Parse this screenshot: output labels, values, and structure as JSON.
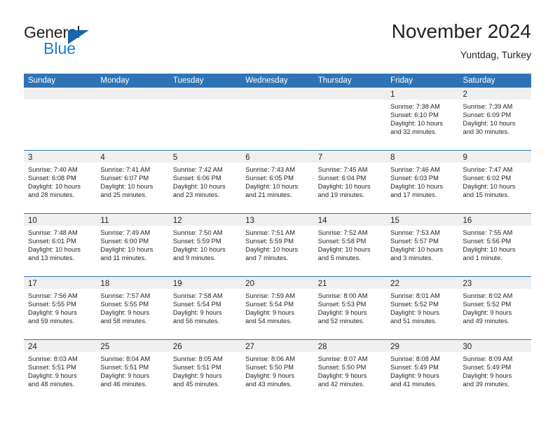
{
  "brand": {
    "name_part1": "General",
    "name_part2": "Blue",
    "mark": "triangle-flag"
  },
  "header": {
    "title": "November 2024",
    "subtitle": "Yuntdag, Turkey"
  },
  "colors": {
    "header_blue": "#2e74b5",
    "brand_blue": "#1b7fd4",
    "mark_blue": "#1866ad",
    "day_band_gray": "#efeff0",
    "text": "#231f20"
  },
  "weekday_headers": [
    "Sunday",
    "Monday",
    "Tuesday",
    "Wednesday",
    "Thursday",
    "Friday",
    "Saturday"
  ],
  "weeks": [
    [
      {
        "day": "",
        "sunrise": "",
        "sunset": "",
        "daylight1": "",
        "daylight2": ""
      },
      {
        "day": "",
        "sunrise": "",
        "sunset": "",
        "daylight1": "",
        "daylight2": ""
      },
      {
        "day": "",
        "sunrise": "",
        "sunset": "",
        "daylight1": "",
        "daylight2": ""
      },
      {
        "day": "",
        "sunrise": "",
        "sunset": "",
        "daylight1": "",
        "daylight2": ""
      },
      {
        "day": "",
        "sunrise": "",
        "sunset": "",
        "daylight1": "",
        "daylight2": ""
      },
      {
        "day": "1",
        "sunrise": "Sunrise: 7:38 AM",
        "sunset": "Sunset: 6:10 PM",
        "daylight1": "Daylight: 10 hours",
        "daylight2": "and 32 minutes."
      },
      {
        "day": "2",
        "sunrise": "Sunrise: 7:39 AM",
        "sunset": "Sunset: 6:09 PM",
        "daylight1": "Daylight: 10 hours",
        "daylight2": "and 30 minutes."
      }
    ],
    [
      {
        "day": "3",
        "sunrise": "Sunrise: 7:40 AM",
        "sunset": "Sunset: 6:08 PM",
        "daylight1": "Daylight: 10 hours",
        "daylight2": "and 28 minutes."
      },
      {
        "day": "4",
        "sunrise": "Sunrise: 7:41 AM",
        "sunset": "Sunset: 6:07 PM",
        "daylight1": "Daylight: 10 hours",
        "daylight2": "and 25 minutes."
      },
      {
        "day": "5",
        "sunrise": "Sunrise: 7:42 AM",
        "sunset": "Sunset: 6:06 PM",
        "daylight1": "Daylight: 10 hours",
        "daylight2": "and 23 minutes."
      },
      {
        "day": "6",
        "sunrise": "Sunrise: 7:43 AM",
        "sunset": "Sunset: 6:05 PM",
        "daylight1": "Daylight: 10 hours",
        "daylight2": "and 21 minutes."
      },
      {
        "day": "7",
        "sunrise": "Sunrise: 7:45 AM",
        "sunset": "Sunset: 6:04 PM",
        "daylight1": "Daylight: 10 hours",
        "daylight2": "and 19 minutes."
      },
      {
        "day": "8",
        "sunrise": "Sunrise: 7:46 AM",
        "sunset": "Sunset: 6:03 PM",
        "daylight1": "Daylight: 10 hours",
        "daylight2": "and 17 minutes."
      },
      {
        "day": "9",
        "sunrise": "Sunrise: 7:47 AM",
        "sunset": "Sunset: 6:02 PM",
        "daylight1": "Daylight: 10 hours",
        "daylight2": "and 15 minutes."
      }
    ],
    [
      {
        "day": "10",
        "sunrise": "Sunrise: 7:48 AM",
        "sunset": "Sunset: 6:01 PM",
        "daylight1": "Daylight: 10 hours",
        "daylight2": "and 13 minutes."
      },
      {
        "day": "11",
        "sunrise": "Sunrise: 7:49 AM",
        "sunset": "Sunset: 6:00 PM",
        "daylight1": "Daylight: 10 hours",
        "daylight2": "and 11 minutes."
      },
      {
        "day": "12",
        "sunrise": "Sunrise: 7:50 AM",
        "sunset": "Sunset: 5:59 PM",
        "daylight1": "Daylight: 10 hours",
        "daylight2": "and 9 minutes."
      },
      {
        "day": "13",
        "sunrise": "Sunrise: 7:51 AM",
        "sunset": "Sunset: 5:59 PM",
        "daylight1": "Daylight: 10 hours",
        "daylight2": "and 7 minutes."
      },
      {
        "day": "14",
        "sunrise": "Sunrise: 7:52 AM",
        "sunset": "Sunset: 5:58 PM",
        "daylight1": "Daylight: 10 hours",
        "daylight2": "and 5 minutes."
      },
      {
        "day": "15",
        "sunrise": "Sunrise: 7:53 AM",
        "sunset": "Sunset: 5:57 PM",
        "daylight1": "Daylight: 10 hours",
        "daylight2": "and 3 minutes."
      },
      {
        "day": "16",
        "sunrise": "Sunrise: 7:55 AM",
        "sunset": "Sunset: 5:56 PM",
        "daylight1": "Daylight: 10 hours",
        "daylight2": "and 1 minute."
      }
    ],
    [
      {
        "day": "17",
        "sunrise": "Sunrise: 7:56 AM",
        "sunset": "Sunset: 5:55 PM",
        "daylight1": "Daylight: 9 hours",
        "daylight2": "and 59 minutes."
      },
      {
        "day": "18",
        "sunrise": "Sunrise: 7:57 AM",
        "sunset": "Sunset: 5:55 PM",
        "daylight1": "Daylight: 9 hours",
        "daylight2": "and 58 minutes."
      },
      {
        "day": "19",
        "sunrise": "Sunrise: 7:58 AM",
        "sunset": "Sunset: 5:54 PM",
        "daylight1": "Daylight: 9 hours",
        "daylight2": "and 56 minutes."
      },
      {
        "day": "20",
        "sunrise": "Sunrise: 7:59 AM",
        "sunset": "Sunset: 5:54 PM",
        "daylight1": "Daylight: 9 hours",
        "daylight2": "and 54 minutes."
      },
      {
        "day": "21",
        "sunrise": "Sunrise: 8:00 AM",
        "sunset": "Sunset: 5:53 PM",
        "daylight1": "Daylight: 9 hours",
        "daylight2": "and 52 minutes."
      },
      {
        "day": "22",
        "sunrise": "Sunrise: 8:01 AM",
        "sunset": "Sunset: 5:52 PM",
        "daylight1": "Daylight: 9 hours",
        "daylight2": "and 51 minutes."
      },
      {
        "day": "23",
        "sunrise": "Sunrise: 8:02 AM",
        "sunset": "Sunset: 5:52 PM",
        "daylight1": "Daylight: 9 hours",
        "daylight2": "and 49 minutes."
      }
    ],
    [
      {
        "day": "24",
        "sunrise": "Sunrise: 8:03 AM",
        "sunset": "Sunset: 5:51 PM",
        "daylight1": "Daylight: 9 hours",
        "daylight2": "and 48 minutes."
      },
      {
        "day": "25",
        "sunrise": "Sunrise: 8:04 AM",
        "sunset": "Sunset: 5:51 PM",
        "daylight1": "Daylight: 9 hours",
        "daylight2": "and 46 minutes."
      },
      {
        "day": "26",
        "sunrise": "Sunrise: 8:05 AM",
        "sunset": "Sunset: 5:51 PM",
        "daylight1": "Daylight: 9 hours",
        "daylight2": "and 45 minutes."
      },
      {
        "day": "27",
        "sunrise": "Sunrise: 8:06 AM",
        "sunset": "Sunset: 5:50 PM",
        "daylight1": "Daylight: 9 hours",
        "daylight2": "and 43 minutes."
      },
      {
        "day": "28",
        "sunrise": "Sunrise: 8:07 AM",
        "sunset": "Sunset: 5:50 PM",
        "daylight1": "Daylight: 9 hours",
        "daylight2": "and 42 minutes."
      },
      {
        "day": "29",
        "sunrise": "Sunrise: 8:08 AM",
        "sunset": "Sunset: 5:49 PM",
        "daylight1": "Daylight: 9 hours",
        "daylight2": "and 41 minutes."
      },
      {
        "day": "30",
        "sunrise": "Sunrise: 8:09 AM",
        "sunset": "Sunset: 5:49 PM",
        "daylight1": "Daylight: 9 hours",
        "daylight2": "and 39 minutes."
      }
    ]
  ]
}
